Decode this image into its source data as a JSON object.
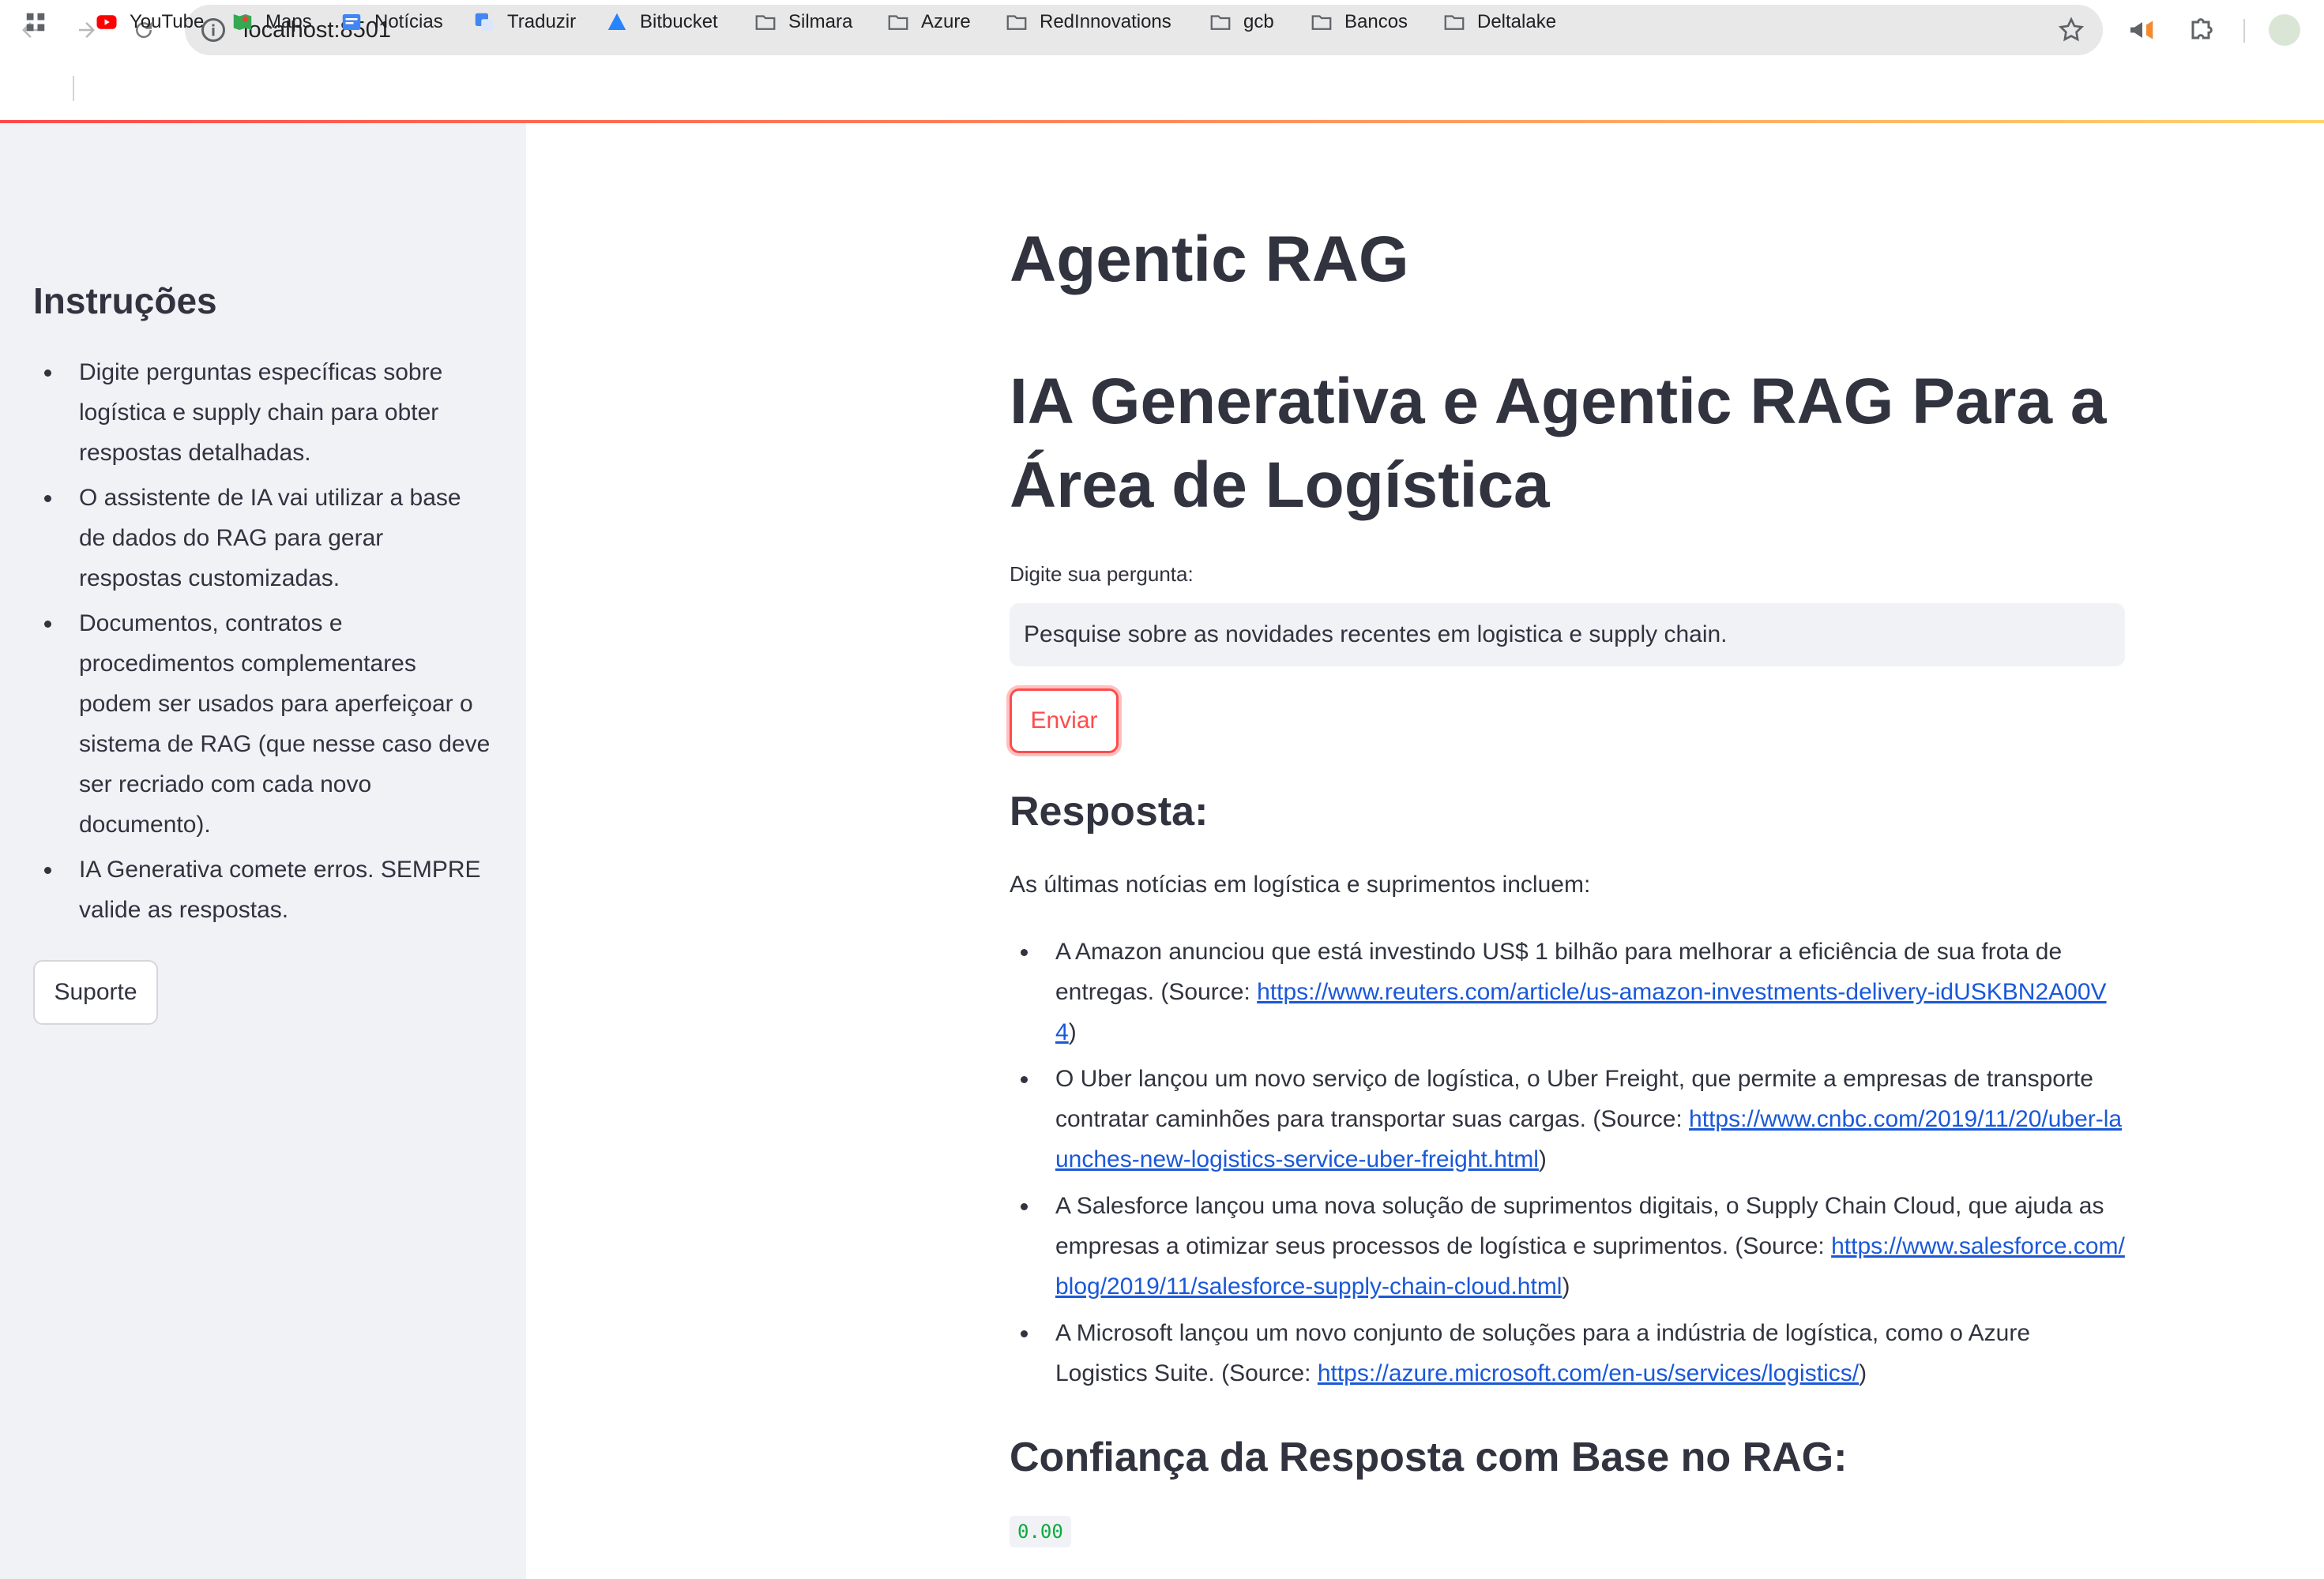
{
  "browser": {
    "url": "localhost:8501",
    "bookmarks": [
      "YouTube",
      "Maps",
      "Notícias",
      "Traduzir",
      "Bitbucket",
      "Silmara",
      "Azure",
      "RedInnovations",
      "gcb",
      "Bancos",
      "Deltalake"
    ]
  },
  "sidebar": {
    "heading": "Instruções",
    "items": [
      "Digite perguntas específicas sobre logística e supply chain para obter respostas detalhadas.",
      "O assistente de IA vai utilizar a base de dados do RAG para gerar respostas customizadas.",
      "Documentos, contratos e procedimentos complementares podem ser usados para aperfeiçoar o sistema de RAG (que nesse caso deve ser recriado com cada novo documento).",
      "IA Generativa comete erros. SEMPRE valide as respostas."
    ],
    "support_label": "Suporte"
  },
  "main": {
    "title": "Agentic RAG",
    "subtitle": "IA Generativa e Agentic RAG Para a Área de Logística",
    "input_label": "Digite sua pergunta:",
    "input_value": "Pesquise sobre as novidades recentes em logistica e supply chain.",
    "send_label": "Enviar",
    "response_heading": "Resposta:",
    "response_intro": "As últimas notícias em logística e suprimentos incluem:",
    "news": [
      {
        "text": "A Amazon anunciou que está investindo US$ 1 bilhão para melhorar a eficiência de sua frota de entregas. (Source: ",
        "link": "https://www.reuters.com/article/us-amazon-investments-delivery-idUSKBN2A00V4",
        "tail": ")"
      },
      {
        "text": "O Uber lançou um novo serviço de logística, o Uber Freight, que permite a empresas de transporte contratar caminhões para transportar suas cargas. (Source: ",
        "link": "https://www.cnbc.com/2019/11/20/uber-launches-new-logistics-service-uber-freight.html",
        "tail": ")"
      },
      {
        "text": "A Salesforce lançou uma nova solução de suprimentos digitais, o Supply Chain Cloud, que ajuda as empresas a otimizar seus processos de logística e suprimentos. (Source: ",
        "link": "https://www.salesforce.com/blog/2019/11/salesforce-supply-chain-cloud.html",
        "tail": ")"
      },
      {
        "text": "A Microsoft lançou um novo conjunto de soluções para a indústria de logística, como o Azure Logistics Suite. (Source: ",
        "link": "https://azure.microsoft.com/en-us/services/logistics/",
        "tail": ")"
      }
    ],
    "confidence_heading": "Confiança da Resposta com Base no RAG:",
    "confidence_value": "0.00"
  },
  "colors": {
    "accent": "#ff4b4b",
    "sidebar_bg": "#f0f2f6",
    "link": "#1a58d8",
    "code_green": "#09ab3b"
  }
}
